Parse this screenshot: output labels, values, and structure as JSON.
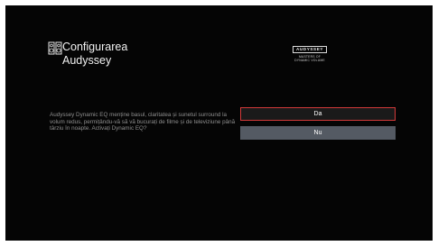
{
  "header": {
    "title_line1": "Configurarea",
    "title_line2": "Audyssey",
    "icon": "speakers-icon"
  },
  "logo": {
    "brand": "AUDYSSEY",
    "line1": "MASTERS OF",
    "line2": "DYNAMIC VOLUME"
  },
  "message": "Audyssey Dynamic EQ menține basul, claritatea și sunetul surround la volum redus, permițându-vă să vă bucurați de filme și de televiziune până târziu în noapte. Activați Dynamic EQ?",
  "options": {
    "yes_label": "Da",
    "no_label": "Nu",
    "selected": "Da"
  },
  "colors": {
    "background": "#050505",
    "selection_border": "#d33a3a",
    "option_inactive": "#545a63"
  }
}
